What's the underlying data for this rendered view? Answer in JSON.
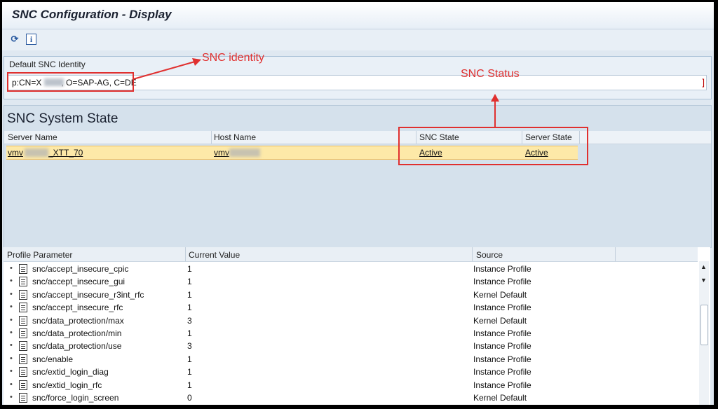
{
  "window": {
    "title": "SNC Configuration - Display"
  },
  "toolbar": {
    "icons": [
      "refresh-icon",
      "info-icon"
    ]
  },
  "identity": {
    "label": "Default SNC Identity",
    "value_prefix": "p:CN=X",
    "value_suffix": ", O=SAP-AG, C=DE",
    "end_marker": "]"
  },
  "system_state": {
    "title": "SNC System State",
    "columns": [
      "Server Name",
      "Host Name",
      "SNC State",
      "Server State"
    ],
    "row": {
      "server_prefix": "vmv",
      "server_suffix": "_XTT_70",
      "host_prefix": "vmv",
      "snc_state": "Active",
      "server_state": "Active"
    }
  },
  "parameters": {
    "columns": [
      "Profile Parameter",
      "Current Value",
      "Source"
    ],
    "rows": [
      {
        "name": "snc/accept_insecure_cpic",
        "value": "1",
        "source": "Instance Profile"
      },
      {
        "name": "snc/accept_insecure_gui",
        "value": "1",
        "source": "Instance Profile"
      },
      {
        "name": "snc/accept_insecure_r3int_rfc",
        "value": "1",
        "source": "Kernel Default"
      },
      {
        "name": "snc/accept_insecure_rfc",
        "value": "1",
        "source": "Instance Profile"
      },
      {
        "name": "snc/data_protection/max",
        "value": "3",
        "source": "Kernel Default"
      },
      {
        "name": "snc/data_protection/min",
        "value": "1",
        "source": "Instance Profile"
      },
      {
        "name": "snc/data_protection/use",
        "value": "3",
        "source": "Instance Profile"
      },
      {
        "name": "snc/enable",
        "value": "1",
        "source": "Instance Profile"
      },
      {
        "name": "snc/extid_login_diag",
        "value": "1",
        "source": "Instance Profile"
      },
      {
        "name": "snc/extid_login_rfc",
        "value": "1",
        "source": "Instance Profile"
      },
      {
        "name": "snc/force_login_screen",
        "value": "0",
        "source": "Kernel Default"
      }
    ]
  },
  "annotations": {
    "identity": "SNC identity",
    "status": "SNC Status",
    "color": "#e0302f"
  }
}
